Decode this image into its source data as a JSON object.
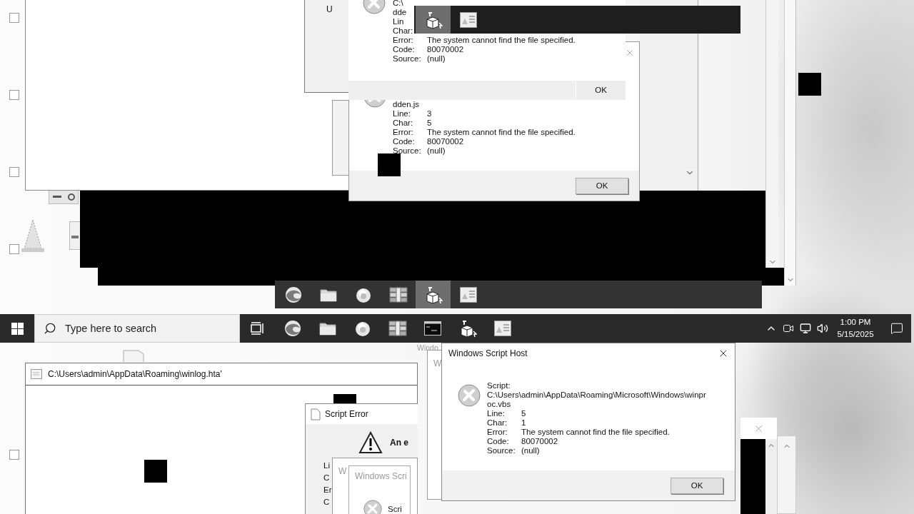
{
  "upper_hta_window": {
    "corner_text": "U"
  },
  "upper_back_dialog": {
    "rows": [
      {
        "label": "C:\\"
      },
      {
        "label": "dde"
      },
      {
        "label": "Lin"
      },
      {
        "label": "Char:"
      },
      {
        "label": "Error:",
        "value": "The system cannot find the file specified."
      },
      {
        "label": "Code:",
        "value": "80070002"
      },
      {
        "label": "Source:",
        "value": "(null)"
      }
    ],
    "button": "OK"
  },
  "upper_front_dialog": {
    "rows": [
      {
        "label": "dden.js"
      },
      {
        "label": "Line:",
        "value": "3"
      },
      {
        "label": "Char:",
        "value": "5"
      },
      {
        "label": "Error:",
        "value": "The system cannot find the file specified."
      },
      {
        "label": "Code:",
        "value": "80070002"
      },
      {
        "label": "Source:",
        "value": "(null)"
      }
    ],
    "button": "OK"
  },
  "top_strip": {
    "items": [
      {
        "kind": "cube",
        "selected": true
      },
      {
        "kind": "image",
        "selected": false
      }
    ]
  },
  "ghost_taskbar": {
    "items": [
      {
        "kind": "browser",
        "selected": false
      },
      {
        "kind": "folder",
        "selected": false
      },
      {
        "kind": "fox",
        "selected": false
      },
      {
        "kind": "archive",
        "selected": false
      },
      {
        "kind": "cube",
        "selected": true
      },
      {
        "kind": "image",
        "selected": false
      }
    ]
  },
  "taskbar": {
    "search": {
      "placeholder": "Type here to search"
    },
    "items": [
      {
        "kind": "taskview",
        "selected": false
      },
      {
        "kind": "browser",
        "selected": false
      },
      {
        "kind": "folder",
        "selected": false
      },
      {
        "kind": "fox",
        "selected": false
      },
      {
        "kind": "archive",
        "selected": false
      },
      {
        "kind": "terminal",
        "selected": false
      },
      {
        "kind": "cube",
        "selected": false
      },
      {
        "kind": "image",
        "selected": false
      }
    ],
    "clock": {
      "time": "1:00 PM",
      "date": "5/15/2025"
    }
  },
  "hta_window": {
    "title": "C:\\Users\\admin\\AppData\\Roaming\\winlog.hta'"
  },
  "script_error_dialog": {
    "title": "Script Error",
    "message": "An e",
    "labels": [
      "Li",
      "C",
      "Er",
      "C"
    ]
  },
  "ghost_dialog": {
    "title": "W",
    "inner_title": "Windows Scri",
    "inner_label": "Scri"
  },
  "side_ghost": {
    "title": "Windo",
    "inner_title": "W"
  },
  "wsh_dialog": {
    "title": "Windows Script Host",
    "rows": [
      {
        "label": "Script:"
      },
      {
        "label": "C:\\Users\\admin\\AppData\\Roaming\\Microsoft\\Windows\\winpr"
      },
      {
        "label": "oc.vbs"
      },
      {
        "label": "Line:",
        "value": "5"
      },
      {
        "label": "Char:",
        "value": "1"
      },
      {
        "label": "Error:",
        "value": "The system cannot find the file specified."
      },
      {
        "label": "Code:",
        "value": "80070002"
      },
      {
        "label": "Source:",
        "value": "(null)"
      }
    ],
    "button": "OK"
  }
}
